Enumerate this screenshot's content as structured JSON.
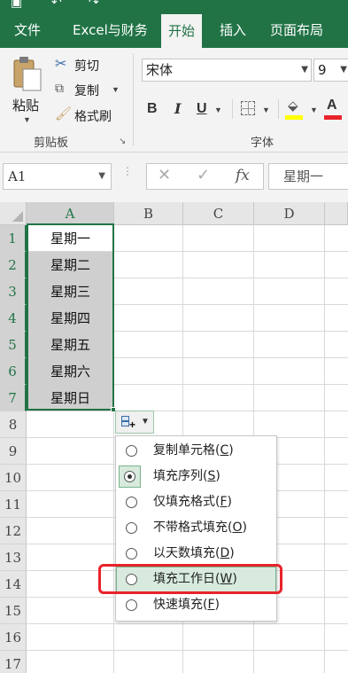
{
  "ribbon_tabs": [
    {
      "label": "文件"
    },
    {
      "label": "Excel与财务"
    },
    {
      "label": "开始",
      "active": true
    },
    {
      "label": "插入"
    },
    {
      "label": "页面布局"
    }
  ],
  "clipboard": {
    "paste_label": "粘贴",
    "cut_label": "剪切",
    "copy_label": "复制",
    "format_painter_label": "格式刷",
    "group_label": "剪贴板"
  },
  "font": {
    "name": "宋体",
    "size": "9",
    "bold": "B",
    "italic": "I",
    "underline": "U",
    "group_label": "字体",
    "fill_color": "#ffff00",
    "font_color": "#e8232b"
  },
  "formula_bar": {
    "name_box": "A1",
    "fx_label": "fx",
    "content": "星期一"
  },
  "grid": {
    "columns": [
      "A",
      "B",
      "C",
      "D"
    ],
    "rows": [
      "1",
      "2",
      "3",
      "4",
      "5",
      "6",
      "7",
      "8",
      "9",
      "10",
      "11",
      "12",
      "13",
      "14",
      "15",
      "16",
      "17"
    ],
    "col_a_values": [
      "星期一",
      "星期二",
      "星期三",
      "星期四",
      "星期五",
      "星期六",
      "星期日"
    ]
  },
  "autofill_menu": {
    "items": [
      {
        "text": "复制单元格",
        "key": "C",
        "checked": false
      },
      {
        "text": "填充序列",
        "key": "S",
        "checked": true
      },
      {
        "text": "仅填充格式",
        "key": "F",
        "checked": false
      },
      {
        "text": "不带格式填充",
        "key": "O",
        "checked": false
      },
      {
        "text": "以天数填充",
        "key": "D",
        "checked": false
      },
      {
        "text": "填充工作日",
        "key": "W",
        "checked": false,
        "highlighted": true
      },
      {
        "text": "快速填充",
        "key": "F",
        "checked": false
      }
    ]
  },
  "colors": {
    "accent": "#217346",
    "highlight_box": "#e8232b"
  }
}
